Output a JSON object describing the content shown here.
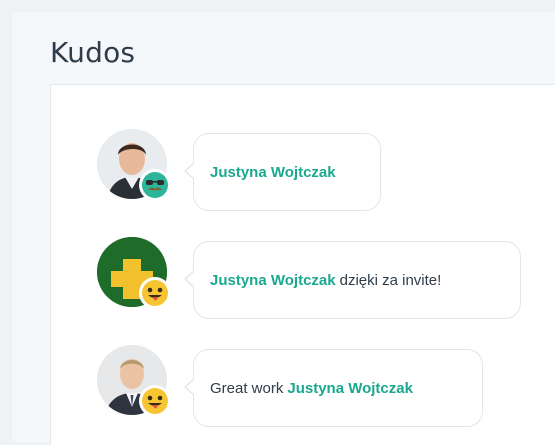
{
  "header": {
    "title": "Kudos"
  },
  "kudos": [
    {
      "avatar": "photo-avatar-man",
      "badge": "mustache-glasses-emoji-icon",
      "prefix": "",
      "name": "Justyna Wojtczak",
      "suffix": ""
    },
    {
      "avatar": "green-yellow-logo-avatar",
      "badge": "tongue-out-emoji-icon",
      "prefix": "",
      "name": "Justyna Wojtczak",
      "suffix": "dzięki za invite!"
    },
    {
      "avatar": "photo-avatar-man-suit",
      "badge": "tongue-out-emoji-icon",
      "prefix": "Great work",
      "name": "Justyna Wojtczak",
      "suffix": ""
    }
  ],
  "colors": {
    "accent": "#1aa88f",
    "text": "#2f3d4a",
    "badge_green": "#2cb59b",
    "badge_yellow": "#f7c531"
  }
}
